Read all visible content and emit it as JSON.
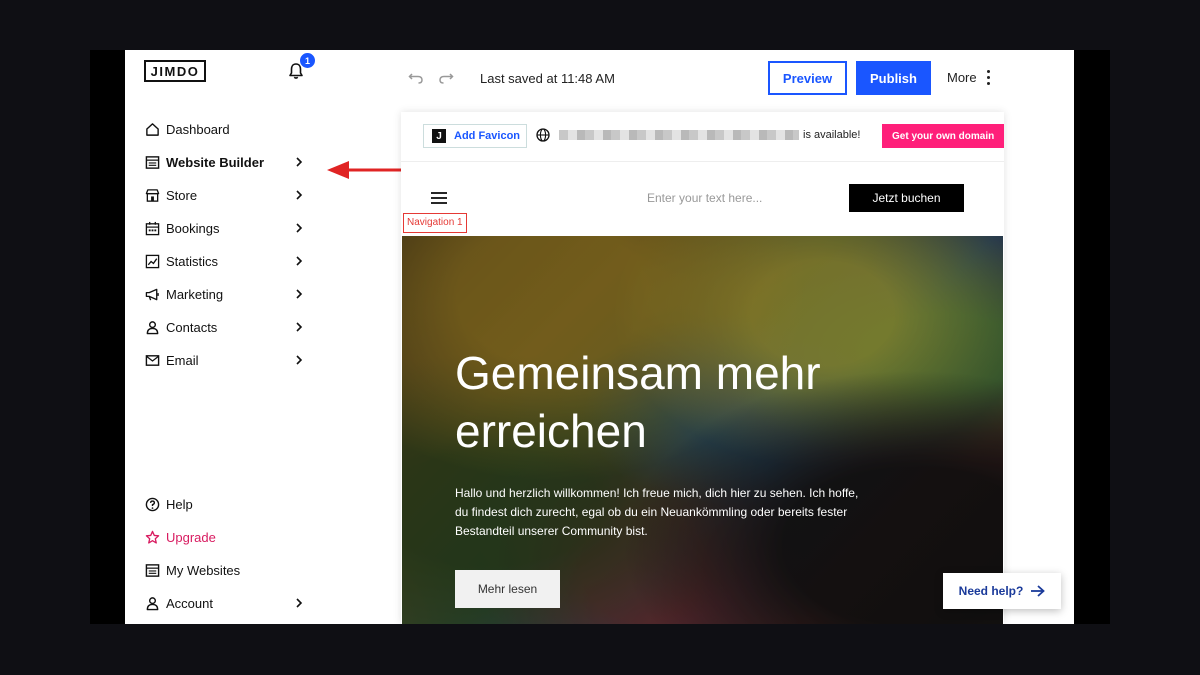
{
  "brand": {
    "logo": "JIMDO",
    "notification_count": "1"
  },
  "toolbar": {
    "last_saved": "Last saved at 11:48 AM",
    "preview_label": "Preview",
    "publish_label": "Publish",
    "more_label": "More"
  },
  "sidebar": {
    "items": [
      {
        "label": "Dashboard"
      },
      {
        "label": "Website Builder"
      },
      {
        "label": "Store"
      },
      {
        "label": "Bookings"
      },
      {
        "label": "Statistics"
      },
      {
        "label": "Marketing"
      },
      {
        "label": "Contacts"
      },
      {
        "label": "Email"
      }
    ],
    "bottom_items": [
      {
        "label": "Help"
      },
      {
        "label": "Upgrade"
      },
      {
        "label": "My Websites"
      },
      {
        "label": "Account"
      }
    ]
  },
  "domain_bar": {
    "favicon_label": "Add Favicon",
    "favicon_icon_letter": "J",
    "available_text": "is available!",
    "cta_label": "Get your own domain"
  },
  "site_nav": {
    "navigation_label": "Navigation 1",
    "text_placeholder": "Enter your text here...",
    "book_button": "Jetzt buchen"
  },
  "hero": {
    "title": "Gemeinsam mehr erreichen",
    "body": "Hallo und herzlich willkommen! Ich freue mich, dich hier zu sehen. Ich hoffe, du findest dich zurecht, egal ob du ein Neuankömmling oder bereits fester Bestandteil unserer Community bist.",
    "button": "Mehr lesen"
  },
  "help_widget": {
    "label": "Need help?"
  },
  "colors": {
    "accent": "#1a56ff",
    "domain_cta": "#ff1f7a",
    "upgrade": "#d81b60",
    "annotation_arrow": "#e02424"
  }
}
